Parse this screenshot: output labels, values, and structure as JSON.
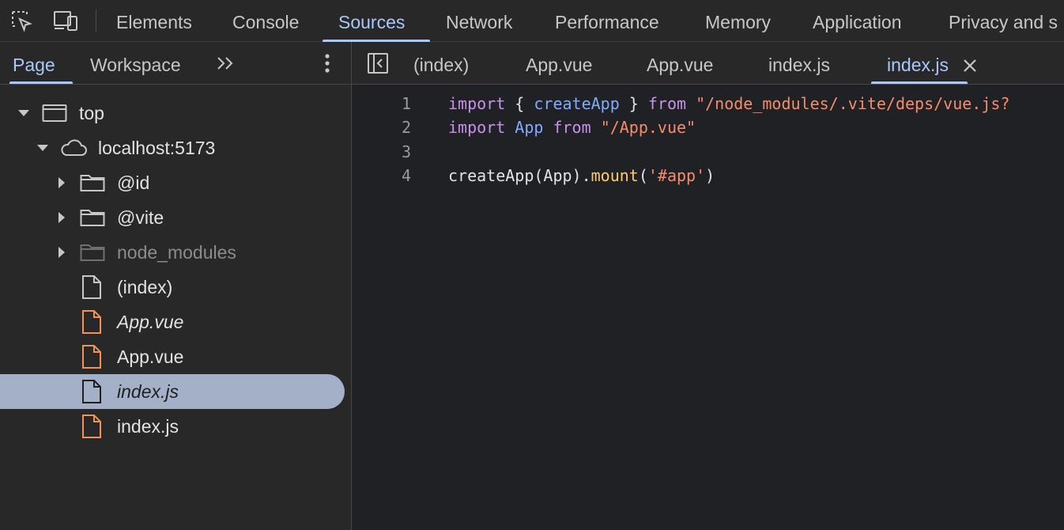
{
  "toolbar": {
    "icons": [
      "inspect-element-icon",
      "device-toolbar-icon"
    ],
    "tabs": [
      {
        "label": "Elements"
      },
      {
        "label": "Console"
      },
      {
        "label": "Sources"
      },
      {
        "label": "Network"
      },
      {
        "label": "Performance"
      },
      {
        "label": "Memory"
      },
      {
        "label": "Application"
      },
      {
        "label": "Privacy and s"
      }
    ],
    "active_tab": "Sources"
  },
  "navigator": {
    "tabs": [
      {
        "label": "Page"
      },
      {
        "label": "Workspace"
      }
    ],
    "more_icon": "chevron-double-right-icon",
    "menu_icon": "kebab-menu-icon",
    "tree": [
      {
        "label": "top",
        "icon": "frame-icon",
        "expanded": true
      },
      {
        "label": "localhost:5173",
        "icon": "cloud-icon",
        "expanded": true
      },
      {
        "label": "@id",
        "icon": "folder-icon",
        "expanded": false
      },
      {
        "label": "@vite",
        "icon": "folder-icon",
        "expanded": false
      },
      {
        "label": "node_modules",
        "icon": "folder-icon",
        "expanded": false
      },
      {
        "label": "(index)",
        "icon": "file-icon"
      },
      {
        "label": "App.vue",
        "icon": "file-icon"
      },
      {
        "label": "App.vue",
        "icon": "file-icon"
      },
      {
        "label": "index.js",
        "icon": "file-icon",
        "selected": true
      },
      {
        "label": "index.js",
        "icon": "file-icon"
      }
    ]
  },
  "editor": {
    "toggle_icon": "toggle-navigator-icon",
    "file_tabs": [
      {
        "label": "(index)"
      },
      {
        "label": "App.vue"
      },
      {
        "label": "App.vue"
      },
      {
        "label": "index.js"
      },
      {
        "label": "index.js"
      }
    ],
    "active_file_tab": 4,
    "close_icon": "close-icon",
    "line_numbers": [
      "1",
      "2",
      "3",
      "4"
    ],
    "code": {
      "l1": {
        "kw1": "import",
        "p1": " { ",
        "id1": "createApp",
        "p2": " } ",
        "kw2": "from",
        "p3": " ",
        "str1": "\"/node_modules/.vite/deps/vue.js?"
      },
      "l2": {
        "kw1": "import",
        "p1": " ",
        "id1": "App",
        "p2": " ",
        "kw2": "from",
        "p3": " ",
        "str1": "\"/App.vue\""
      },
      "l4": {
        "p1": "createApp(App).",
        "fn1": "mount",
        "p2": "(",
        "str1": "'#app'",
        "p3": ")"
      }
    }
  },
  "colors": {
    "accent": "#a8c7fa",
    "selection": "#a3b0c8",
    "vue_file": "#f0925a",
    "keyword": "#c792ea",
    "identifier": "#82aaff",
    "string": "#f78c6c",
    "function": "#ffcb6b"
  }
}
